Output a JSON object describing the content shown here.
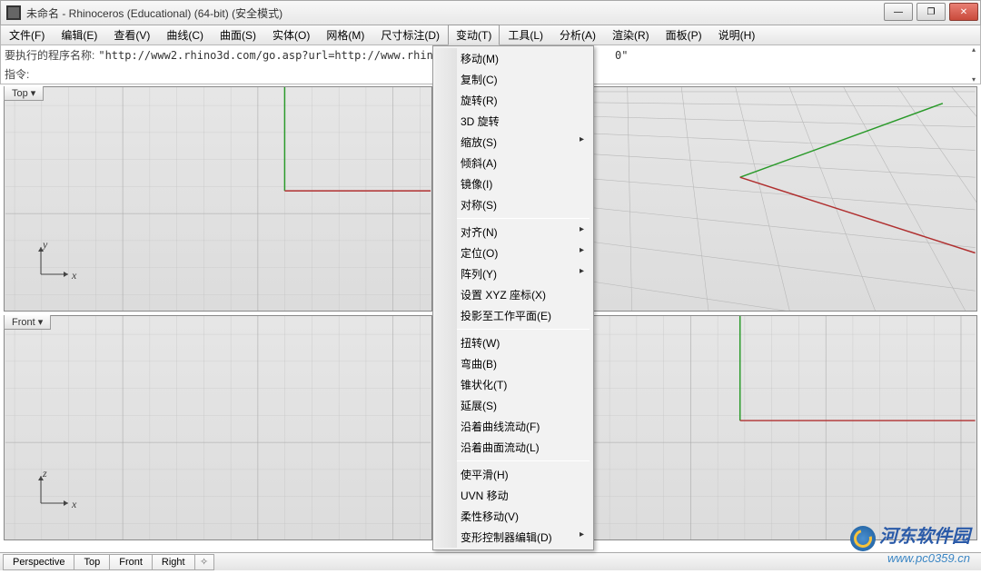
{
  "window": {
    "title": "未命名 - Rhinoceros (Educational) (64-bit) (安全模式)"
  },
  "menu": {
    "items": [
      "文件(F)",
      "编辑(E)",
      "查看(V)",
      "曲线(C)",
      "曲面(S)",
      "实体(O)",
      "网格(M)",
      "尺寸标注(D)",
      "变动(T)",
      "工具(L)",
      "分析(A)",
      "渲染(R)",
      "面板(P)",
      "说明(H)"
    ],
    "active_index": 8
  },
  "command": {
    "line1_label": "要执行的程序名称: ",
    "line1_value": "\"http://www2.rhino3d.com/go.asp?url=http://www.rhino3d.co",
    "line1_trail": "0\"",
    "line2_label": "指令: "
  },
  "viewports": {
    "top_left_label": "Top ▾",
    "bottom_left_label": "Front ▾",
    "axes": {
      "x": "x",
      "y": "y",
      "z": "z"
    }
  },
  "dropdown": {
    "groups": [
      [
        "移动(M)",
        "复制(C)",
        "旋转(R)",
        "3D 旋转",
        {
          "label": "缩放(S)",
          "sub": true
        },
        "倾斜(A)",
        "镜像(I)",
        "对称(S)"
      ],
      [
        {
          "label": "对齐(N)",
          "sub": true
        },
        {
          "label": "定位(O)",
          "sub": true
        },
        {
          "label": "阵列(Y)",
          "sub": true
        },
        "设置 XYZ 座标(X)",
        "投影至工作平面(E)"
      ],
      [
        "扭转(W)",
        "弯曲(B)",
        "锥状化(T)",
        "延展(S)",
        "沿着曲线流动(F)",
        "沿着曲面流动(L)"
      ],
      [
        "使平滑(H)",
        "UVN 移动",
        "柔性移动(V)",
        {
          "label": "变形控制器编辑(D)",
          "sub": true
        }
      ]
    ]
  },
  "bottom_tabs": [
    "Perspective",
    "Top",
    "Front",
    "Right"
  ],
  "watermark": {
    "name": "河东软件园",
    "url": "www.pc0359.cn"
  }
}
